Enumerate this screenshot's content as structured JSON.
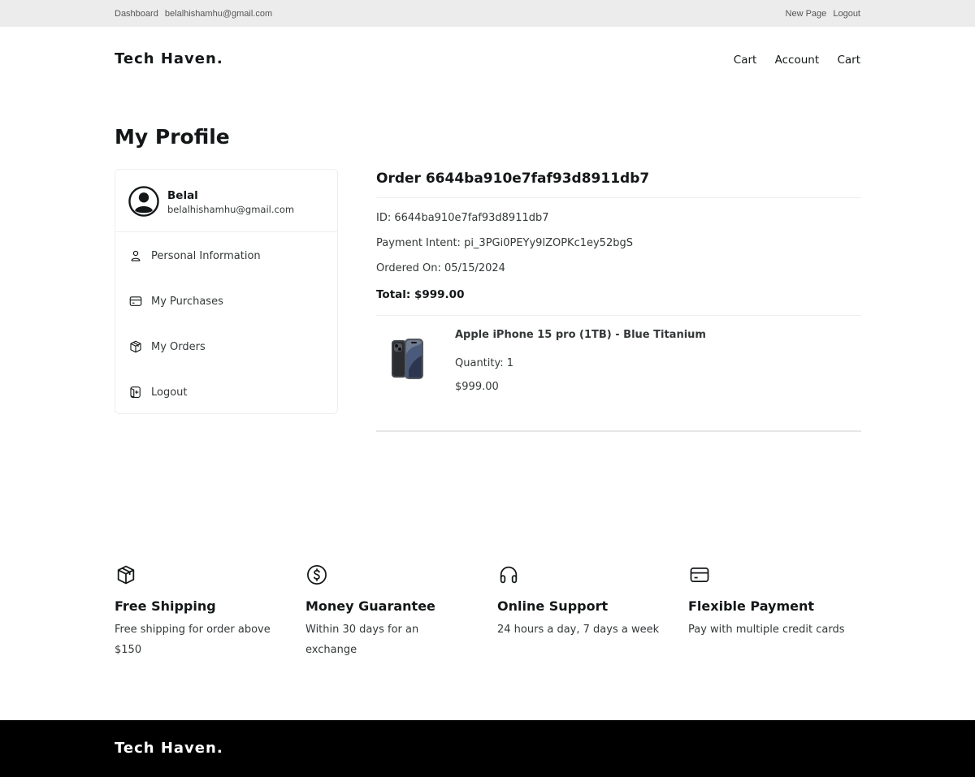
{
  "topbar": {
    "dashboard": "Dashboard",
    "email": "belalhishamhu@gmail.com",
    "new_page": "New Page",
    "logout": "Logout"
  },
  "header": {
    "brand": "Tech Haven.",
    "nav": [
      "Cart",
      "Account",
      "Cart"
    ]
  },
  "page_title": "My Profile",
  "profile": {
    "name": "Belal",
    "email": "belalhishamhu@gmail.com",
    "menu": [
      {
        "label": "Personal Information",
        "icon": "user-icon"
      },
      {
        "label": "My Purchases",
        "icon": "credit-card-icon"
      },
      {
        "label": "My Orders",
        "icon": "box-icon"
      },
      {
        "label": "Logout",
        "icon": "logout-icon"
      }
    ]
  },
  "order": {
    "title": "Order 6644ba910e7faf93d8911db7",
    "id_line": "ID: 6644ba910e7faf93d8911db7",
    "payment_line": "Payment Intent: pi_3PGi0PEYy9lZOPKc1ey52bgS",
    "ordered_line": "Ordered On: 05/15/2024",
    "total_line": "Total: $999.00",
    "item": {
      "name": "Apple iPhone 15 pro (1TB) - Blue Titanium",
      "quantity": "Quantity: 1",
      "price": "$999.00"
    }
  },
  "features": [
    {
      "title": "Free Shipping",
      "desc": "Free shipping for order above $150",
      "icon": "box-icon"
    },
    {
      "title": "Money Guarantee",
      "desc": "Within 30 days for an exchange",
      "icon": "dollar-circle-icon"
    },
    {
      "title": "Online Support",
      "desc": "24 hours a day, 7 days a week",
      "icon": "headphones-icon"
    },
    {
      "title": "Flexible Payment",
      "desc": "Pay with multiple credit cards",
      "icon": "credit-card-icon"
    }
  ],
  "footer": {
    "brand": "Tech Haven."
  }
}
